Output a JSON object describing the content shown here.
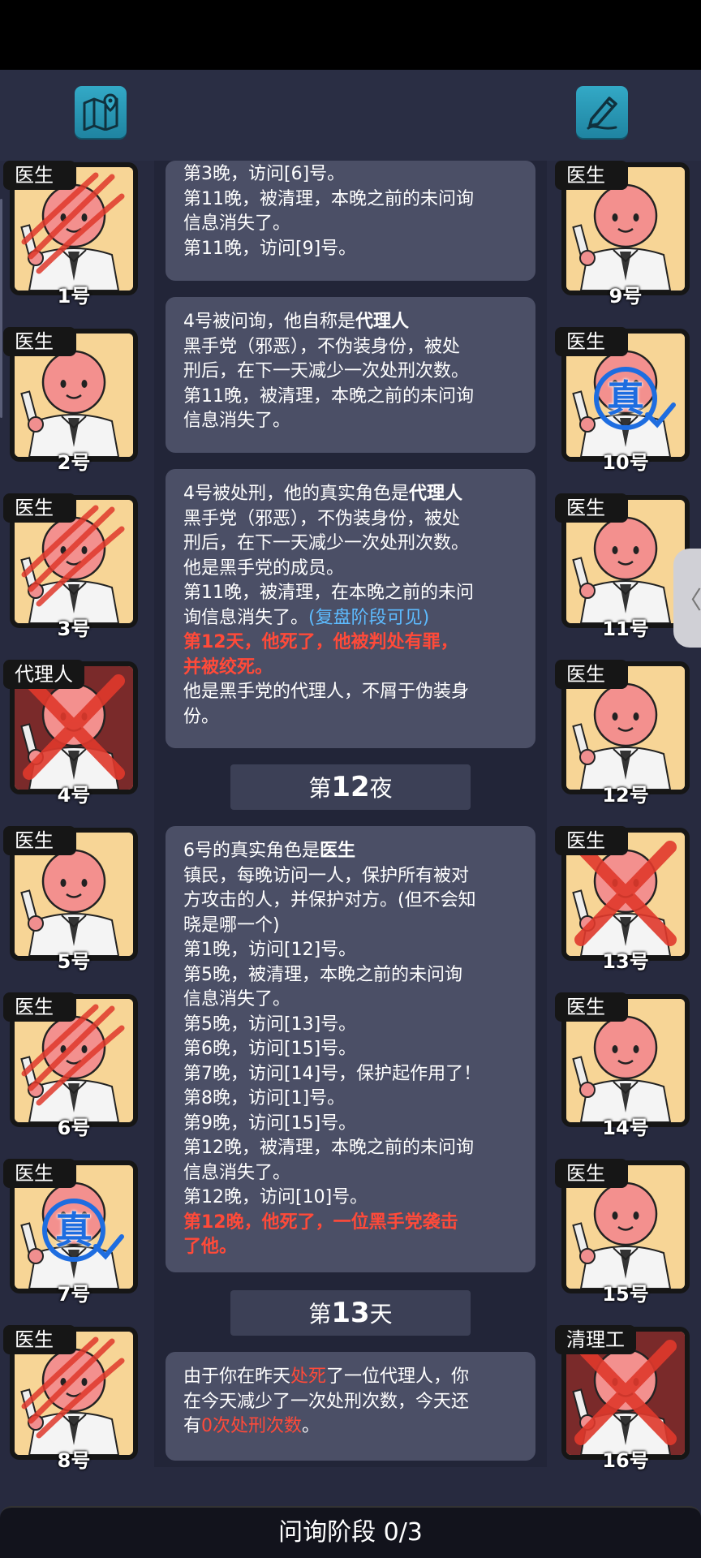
{
  "players_left": [
    {
      "role": "医生",
      "num": "1号",
      "status": "slashed"
    },
    {
      "role": "医生",
      "num": "2号",
      "status": "alive"
    },
    {
      "role": "医生",
      "num": "3号",
      "status": "slashed"
    },
    {
      "role": "代理人",
      "num": "4号",
      "status": "executed"
    },
    {
      "role": "医生",
      "num": "5号",
      "status": "alive"
    },
    {
      "role": "医生",
      "num": "6号",
      "status": "slashed"
    },
    {
      "role": "医生",
      "num": "7号",
      "status": "verified",
      "stamp": "真"
    },
    {
      "role": "医生",
      "num": "8号",
      "status": "slashed"
    }
  ],
  "players_right": [
    {
      "role": "医生",
      "num": "9号",
      "status": "alive"
    },
    {
      "role": "医生",
      "num": "10号",
      "status": "verified",
      "stamp": "真"
    },
    {
      "role": "医生",
      "num": "11号",
      "status": "alive"
    },
    {
      "role": "医生",
      "num": "12号",
      "status": "alive"
    },
    {
      "role": "医生",
      "num": "13号",
      "status": "crossed"
    },
    {
      "role": "医生",
      "num": "14号",
      "status": "alive"
    },
    {
      "role": "医生",
      "num": "15号",
      "status": "alive"
    },
    {
      "role": "清理工",
      "num": "16号",
      "status": "executed"
    }
  ],
  "toolbar": {
    "map_icon": "map-pin-icon",
    "notes_icon": "pen-edit-icon"
  },
  "log": {
    "card1": [
      "第3晚，访问[6]号。",
      "第11晚，被清理，本晚之前的未问询",
      "信息消失了。",
      "第11晚，访问[9]号。"
    ],
    "card2": {
      "title_prefix": "4号被问询，他自称是",
      "title_role": "代理人",
      "lines": [
        "黑手党（邪恶），不伪装身份，被处",
        "刑后，在下一天减少一次处刑次数。",
        "第11晚，被清理，本晚之前的未问询",
        "信息消失了。"
      ]
    },
    "card3": {
      "title_prefix": "4号被处刑，他的真实角色是",
      "title_role": "代理人",
      "lines": [
        "黑手党（邪恶），不伪装身份，被处",
        "刑后，在下一天减少一次处刑次数。",
        "他是黑手党的成员。",
        "第11晚，被清理，在本晚之前的未问"
      ],
      "line_with_note": "询信息消失了。",
      "note": "(复盘阶段可见)",
      "death": [
        "第12天，他死了，他被判处有罪，",
        "并被绞死。"
      ],
      "tail": [
        "他是黑手党的代理人，不屑于伪装身",
        "份。"
      ]
    },
    "divider1": {
      "prefix": "第",
      "num": "12",
      "suffix": "夜"
    },
    "card4": {
      "title_prefix": "6号的真实角色是",
      "title_role": "医生",
      "lines": [
        "镇民，每晚访问一人，保护所有被对",
        "方攻击的人，并保护对方。(但不会知",
        "晓是哪一个)",
        "第1晚，访问[12]号。",
        "第5晚，被清理，本晚之前的未问询",
        "信息消失了。",
        "第5晚，访问[13]号。",
        "第6晚，访问[15]号。",
        "第7晚，访问[14]号，保护起作用了！",
        "第8晚，访问[1]号。",
        "第9晚，访问[15]号。",
        "第12晚，被清理，本晚之前的未问询",
        "信息消失了。",
        "第12晚，访问[10]号。"
      ],
      "death": [
        "第12晚，他死了，一位黑手党袭击",
        "了他。"
      ]
    },
    "divider2": {
      "prefix": "第",
      "num": "13",
      "suffix": "天"
    },
    "card5": {
      "l1_a": "由于你在昨天",
      "l1_b": "处死",
      "l1_c": "了一位代理人，你",
      "l2": "在今天减少了一次处刑次数，今天还",
      "l3_a": "有",
      "l3_b": "0次处刑次数",
      "l3_c": "。"
    }
  },
  "phase": {
    "label": "问询阶段 0/3"
  }
}
